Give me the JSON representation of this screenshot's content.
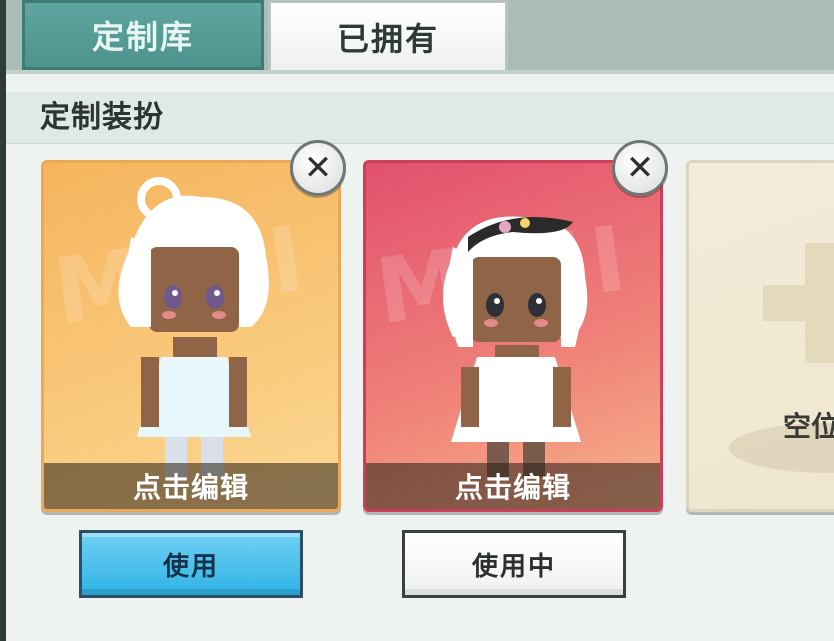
{
  "tabs": [
    {
      "label": "定制库",
      "active": true
    },
    {
      "label": "已拥有",
      "active": false
    }
  ],
  "section": {
    "title": "定制装扮"
  },
  "cards": [
    {
      "edit_label": "点击编辑",
      "action_label": "使用",
      "in_use": false,
      "bg_color": "#f6b45d"
    },
    {
      "edit_label": "点击编辑",
      "action_label": "使用中",
      "in_use": true,
      "bg_color": "#e2506e"
    }
  ],
  "empty_slot": {
    "label": "空位"
  },
  "watermark": "MINI",
  "footer": {
    "title": "",
    "note": ""
  },
  "colors": {
    "accent_blue": "#30b3e6",
    "tab_active": "#4e928c"
  }
}
